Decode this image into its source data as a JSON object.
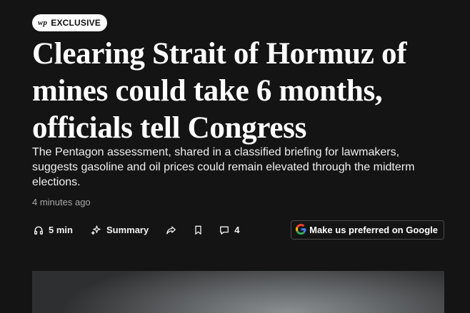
{
  "badge": {
    "logo": "wp",
    "label": "EXCLUSIVE"
  },
  "article": {
    "headline_lines": [
      "Clearing Strait of Hormuz of",
      "mines could take 6 months,",
      "officials tell Congress"
    ],
    "dek": "The Pentagon assessment, shared in a classified briefing for lawmakers, suggests gasoline and oil prices could remain elevated through the midterm elections.",
    "timestamp": "4 minutes ago"
  },
  "toolbar": {
    "listen": {
      "icon": "headphones-icon",
      "label": "5 min"
    },
    "summary": {
      "icon": "sparkle-icon",
      "label": "Summary"
    },
    "share": {
      "icon": "share-icon"
    },
    "save": {
      "icon": "bookmark-icon"
    },
    "comments": {
      "icon": "comment-icon",
      "count": "4"
    },
    "google_preferred": {
      "icon": "google-g-icon",
      "label": "Make us preferred on Google"
    }
  },
  "colors": {
    "background": "#141414",
    "text": "#ffffff",
    "muted": "#a8a8a8",
    "badge_bg": "#ffffff",
    "google_blue": "#4285F4",
    "google_red": "#EA4335",
    "google_yellow": "#FBBC05",
    "google_green": "#34A853"
  }
}
